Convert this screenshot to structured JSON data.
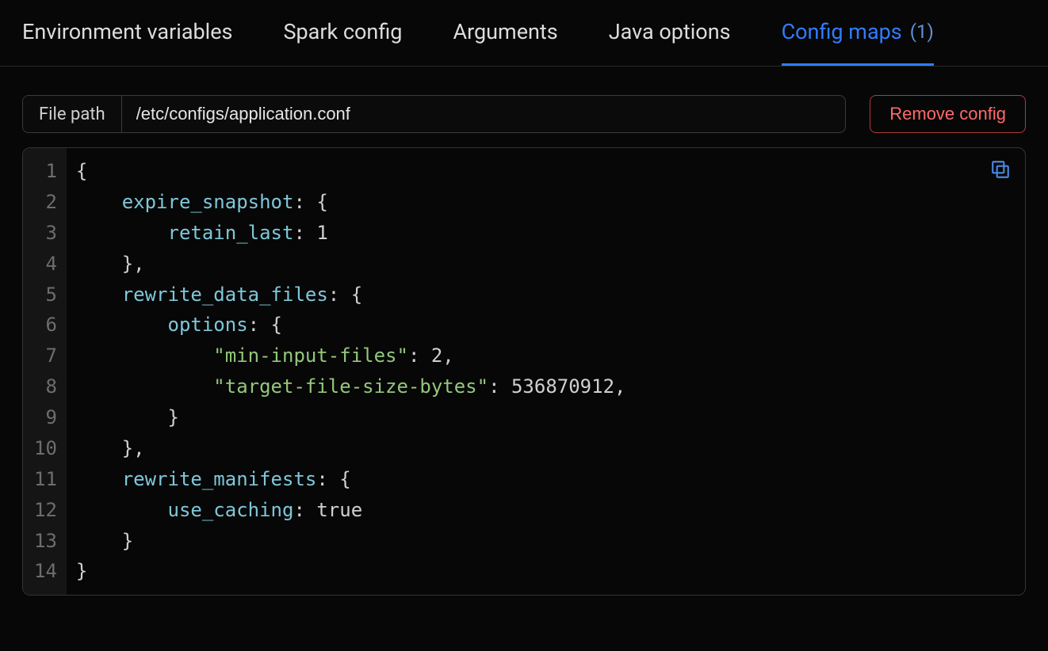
{
  "tabs": [
    {
      "label": "Environment variables",
      "active": false
    },
    {
      "label": "Spark config",
      "active": false
    },
    {
      "label": "Arguments",
      "active": false
    },
    {
      "label": "Java options",
      "active": false
    },
    {
      "label": "Config maps",
      "active": true,
      "badge": "(1)"
    }
  ],
  "filepath": {
    "label": "File path",
    "value": "/etc/configs/application.conf"
  },
  "buttons": {
    "remove": "Remove config"
  },
  "editor": {
    "lines": [
      [
        {
          "t": "punct",
          "v": "{"
        }
      ],
      [
        {
          "t": "indent",
          "v": 1
        },
        {
          "t": "key",
          "v": "expire_snapshot"
        },
        {
          "t": "punct",
          "v": ": {"
        }
      ],
      [
        {
          "t": "indent",
          "v": 2
        },
        {
          "t": "key",
          "v": "retain_last"
        },
        {
          "t": "punct",
          "v": ": "
        },
        {
          "t": "num",
          "v": "1"
        }
      ],
      [
        {
          "t": "indent",
          "v": 1
        },
        {
          "t": "punct",
          "v": "},"
        }
      ],
      [
        {
          "t": "indent",
          "v": 1
        },
        {
          "t": "key",
          "v": "rewrite_data_files"
        },
        {
          "t": "punct",
          "v": ": {"
        }
      ],
      [
        {
          "t": "indent",
          "v": 2
        },
        {
          "t": "key",
          "v": "options"
        },
        {
          "t": "punct",
          "v": ": {"
        }
      ],
      [
        {
          "t": "indent",
          "v": 3
        },
        {
          "t": "str",
          "v": "\"min-input-files\""
        },
        {
          "t": "punct",
          "v": ": "
        },
        {
          "t": "num",
          "v": "2"
        },
        {
          "t": "punct",
          "v": ","
        }
      ],
      [
        {
          "t": "indent",
          "v": 3
        },
        {
          "t": "str",
          "v": "\"target-file-size-bytes\""
        },
        {
          "t": "punct",
          "v": ": "
        },
        {
          "t": "num",
          "v": "536870912"
        },
        {
          "t": "punct",
          "v": ","
        }
      ],
      [
        {
          "t": "indent",
          "v": 2
        },
        {
          "t": "punct",
          "v": "}"
        }
      ],
      [
        {
          "t": "indent",
          "v": 1
        },
        {
          "t": "punct",
          "v": "},"
        }
      ],
      [
        {
          "t": "indent",
          "v": 1
        },
        {
          "t": "key",
          "v": "rewrite_manifests"
        },
        {
          "t": "punct",
          "v": ": {"
        }
      ],
      [
        {
          "t": "indent",
          "v": 2
        },
        {
          "t": "key",
          "v": "use_caching"
        },
        {
          "t": "punct",
          "v": ": "
        },
        {
          "t": "bool",
          "v": "true"
        }
      ],
      [
        {
          "t": "indent",
          "v": 1
        },
        {
          "t": "punct",
          "v": "}"
        }
      ],
      [
        {
          "t": "punct",
          "v": "}"
        }
      ]
    ]
  }
}
